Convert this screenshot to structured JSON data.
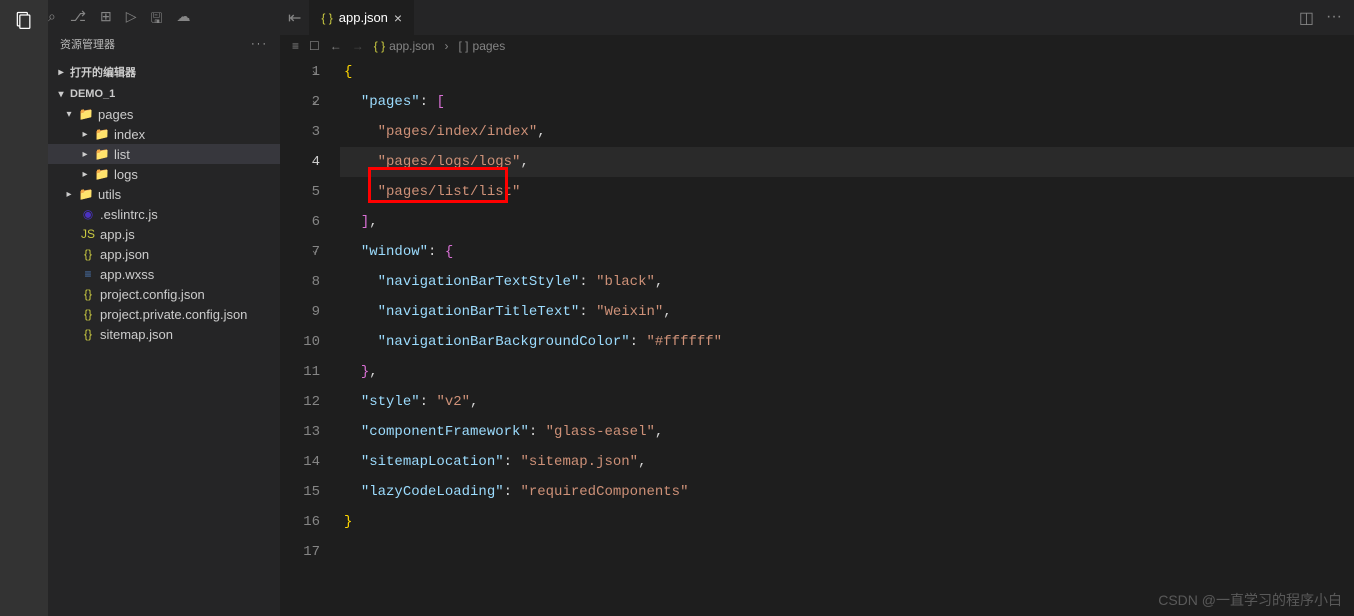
{
  "sidebar": {
    "title": "资源管理器",
    "sections": {
      "openEditors": "打开的编辑器",
      "project": "DEMO_1"
    },
    "tree": {
      "pages": "pages",
      "index": "index",
      "list": "list",
      "logs": "logs",
      "utils": "utils",
      "eslintrc": ".eslintrc.js",
      "appjs": "app.js",
      "appjson": "app.json",
      "appwxss": "app.wxss",
      "projectconfig": "project.config.json",
      "projectprivate": "project.private.config.json",
      "sitemap": "sitemap.json"
    }
  },
  "tabs": {
    "active": "app.json"
  },
  "breadcrumb": {
    "file": "app.json",
    "path": "pages"
  },
  "code": {
    "l1": "{",
    "l2_key": "\"pages\"",
    "l2_colon": ": ",
    "l2_bracket": "[",
    "l3": "\"pages/index/index\"",
    "l4": "\"pages/logs/logs\"",
    "l5": "\"pages/list/list\"",
    "l6_close": "]",
    "l6_comma": ",",
    "l7_key": "\"window\"",
    "l7_brace": "{",
    "l8_key": "\"navigationBarTextStyle\"",
    "l8_val": "\"black\"",
    "l9_key": "\"navigationBarTitleText\"",
    "l9_val": "\"Weixin\"",
    "l10_key": "\"navigationBarBackgroundColor\"",
    "l10_val": "\"#ffffff\"",
    "l11": "}",
    "l12_key": "\"style\"",
    "l12_val": "\"v2\"",
    "l13_key": "\"componentFramework\"",
    "l13_val": "\"glass-easel\"",
    "l14_key": "\"sitemapLocation\"",
    "l14_val": "\"sitemap.json\"",
    "l15_key": "\"lazyCodeLoading\"",
    "l15_val": "\"requiredComponents\"",
    "l16": "}"
  },
  "lineNumbers": [
    "1",
    "2",
    "3",
    "4",
    "5",
    "6",
    "7",
    "8",
    "9",
    "10",
    "11",
    "12",
    "13",
    "14",
    "15",
    "16",
    "17"
  ],
  "watermark": "CSDN @一直学习的程序小白"
}
